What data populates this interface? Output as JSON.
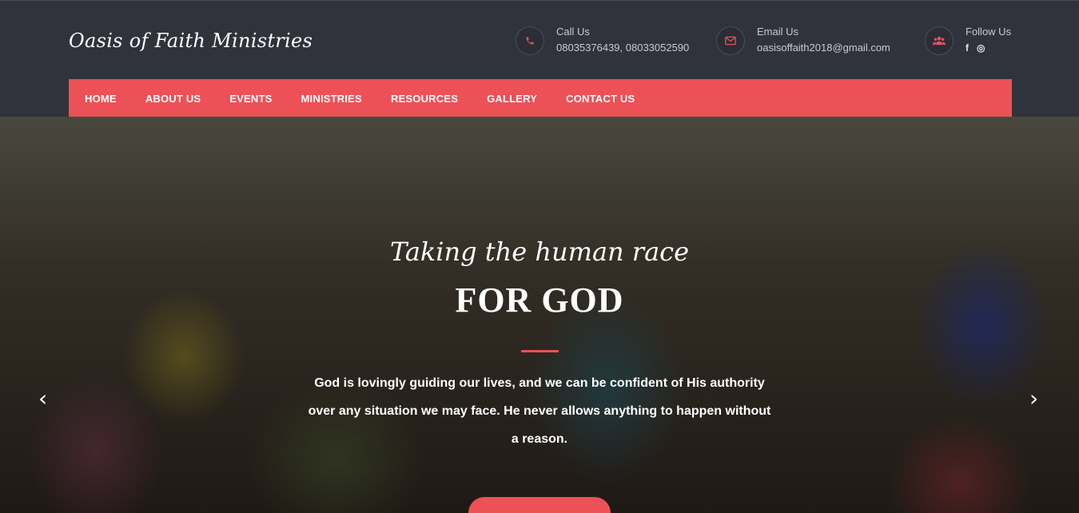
{
  "site": {
    "logo": "Oasis of Faith Ministries"
  },
  "contacts": {
    "call": {
      "label": "Call Us",
      "value": "08035376439, 08033052590",
      "icon": "phone-icon"
    },
    "email": {
      "label": "Email Us",
      "value": "oasisoffaith2018@gmail.com",
      "icon": "envelope-icon"
    },
    "follow": {
      "label": "Follow Us",
      "icon": "users-icon",
      "facebook": "f",
      "instagram": "◎"
    }
  },
  "nav": {
    "items": [
      "HOME",
      "ABOUT US",
      "EVENTS",
      "MINISTRIES",
      "RESOURCES",
      "GALLERY",
      "CONTACT US"
    ]
  },
  "hero": {
    "tagline": "Taking the human race",
    "headline": "FOR GOD",
    "description": "God is lovingly guiding our lives, and we can be confident of His authority over any situation we may face. He never allows anything to happen without a reason.",
    "prev_arrow": "‹",
    "next_arrow": "›"
  },
  "colors": {
    "accent": "#ec5157",
    "header_bg": "#30333c"
  }
}
